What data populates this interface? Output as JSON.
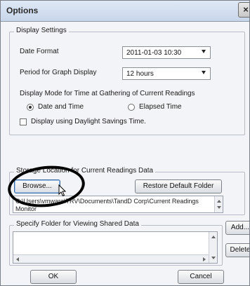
{
  "window": {
    "title": "Options",
    "close_glyph": "×"
  },
  "display_settings": {
    "group_title": "Display Settings",
    "date_format_label": "Date Format",
    "date_format_value": "2011-01-03 10:30",
    "period_label": "Period for Graph Display",
    "period_value": "12 hours",
    "display_mode_label": "Display Mode for Time at Gathering of Current Readings",
    "radio_date_time": "Date and Time",
    "radio_date_time_checked": true,
    "radio_elapsed": "Elapsed Time",
    "radio_elapsed_checked": false,
    "dst_label": "Display using Daylight Savings Time.",
    "dst_checked": false
  },
  "storage": {
    "group_title": "Storage Location for Current Readings Data",
    "browse_label": "Browse...",
    "restore_label": "Restore Default Folder",
    "path_text": "C:\\Users\\vmware\\TRV\\Documents\\TandD Corp\\Current Readings Monitor"
  },
  "shared": {
    "group_title": "Specify Folder for Viewing Shared Data",
    "add_label": "Add...",
    "delete_label": "Delete"
  },
  "footer": {
    "ok_label": "OK",
    "cancel_label": "Cancel"
  },
  "icons": {
    "dropdown": "chevron-down-icon",
    "close": "close-icon",
    "cursor": "mouse-pointer-icon"
  },
  "colors": {
    "titlebar": "#c8d6ea",
    "dialog_bg": "#f3f4f7",
    "annotation": "#000000"
  }
}
